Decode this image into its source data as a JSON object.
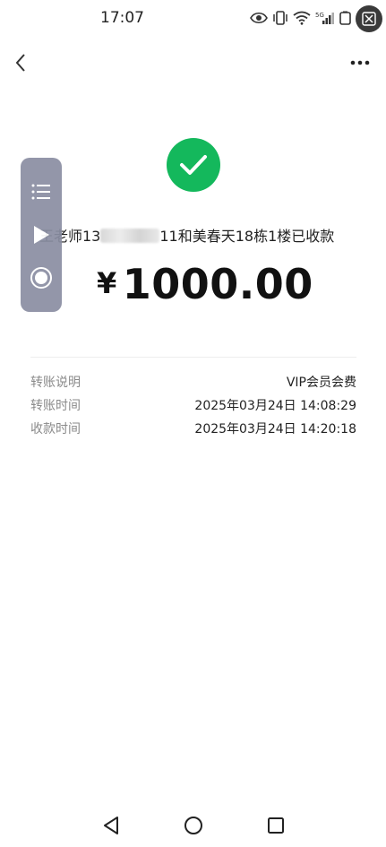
{
  "status_bar": {
    "time": "17:07",
    "signal_label": "5G"
  },
  "nav": {
    "back_icon": "chevron-left-icon",
    "more_icon": "more-dots-icon"
  },
  "result": {
    "status_icon": "check-circle-icon",
    "status_color": "#14b85c",
    "payee_prefix": "王老师13",
    "payee_suffix": "11和美春天18栋1楼已收款",
    "currency_symbol": "¥",
    "amount": "1000.00"
  },
  "details": [
    {
      "label": "转账说明",
      "value": "VIP会员会费"
    },
    {
      "label": "转账时间",
      "value": "2025年03月24日 14:08:29"
    },
    {
      "label": "收款时间",
      "value": "2025年03月24日 14:20:18"
    }
  ],
  "floating_toolbar": {
    "buttons": [
      "list-icon",
      "play-icon",
      "record-icon"
    ]
  },
  "system_nav": {
    "buttons": [
      "back-triangle-icon",
      "home-circle-icon",
      "recents-square-icon"
    ]
  }
}
